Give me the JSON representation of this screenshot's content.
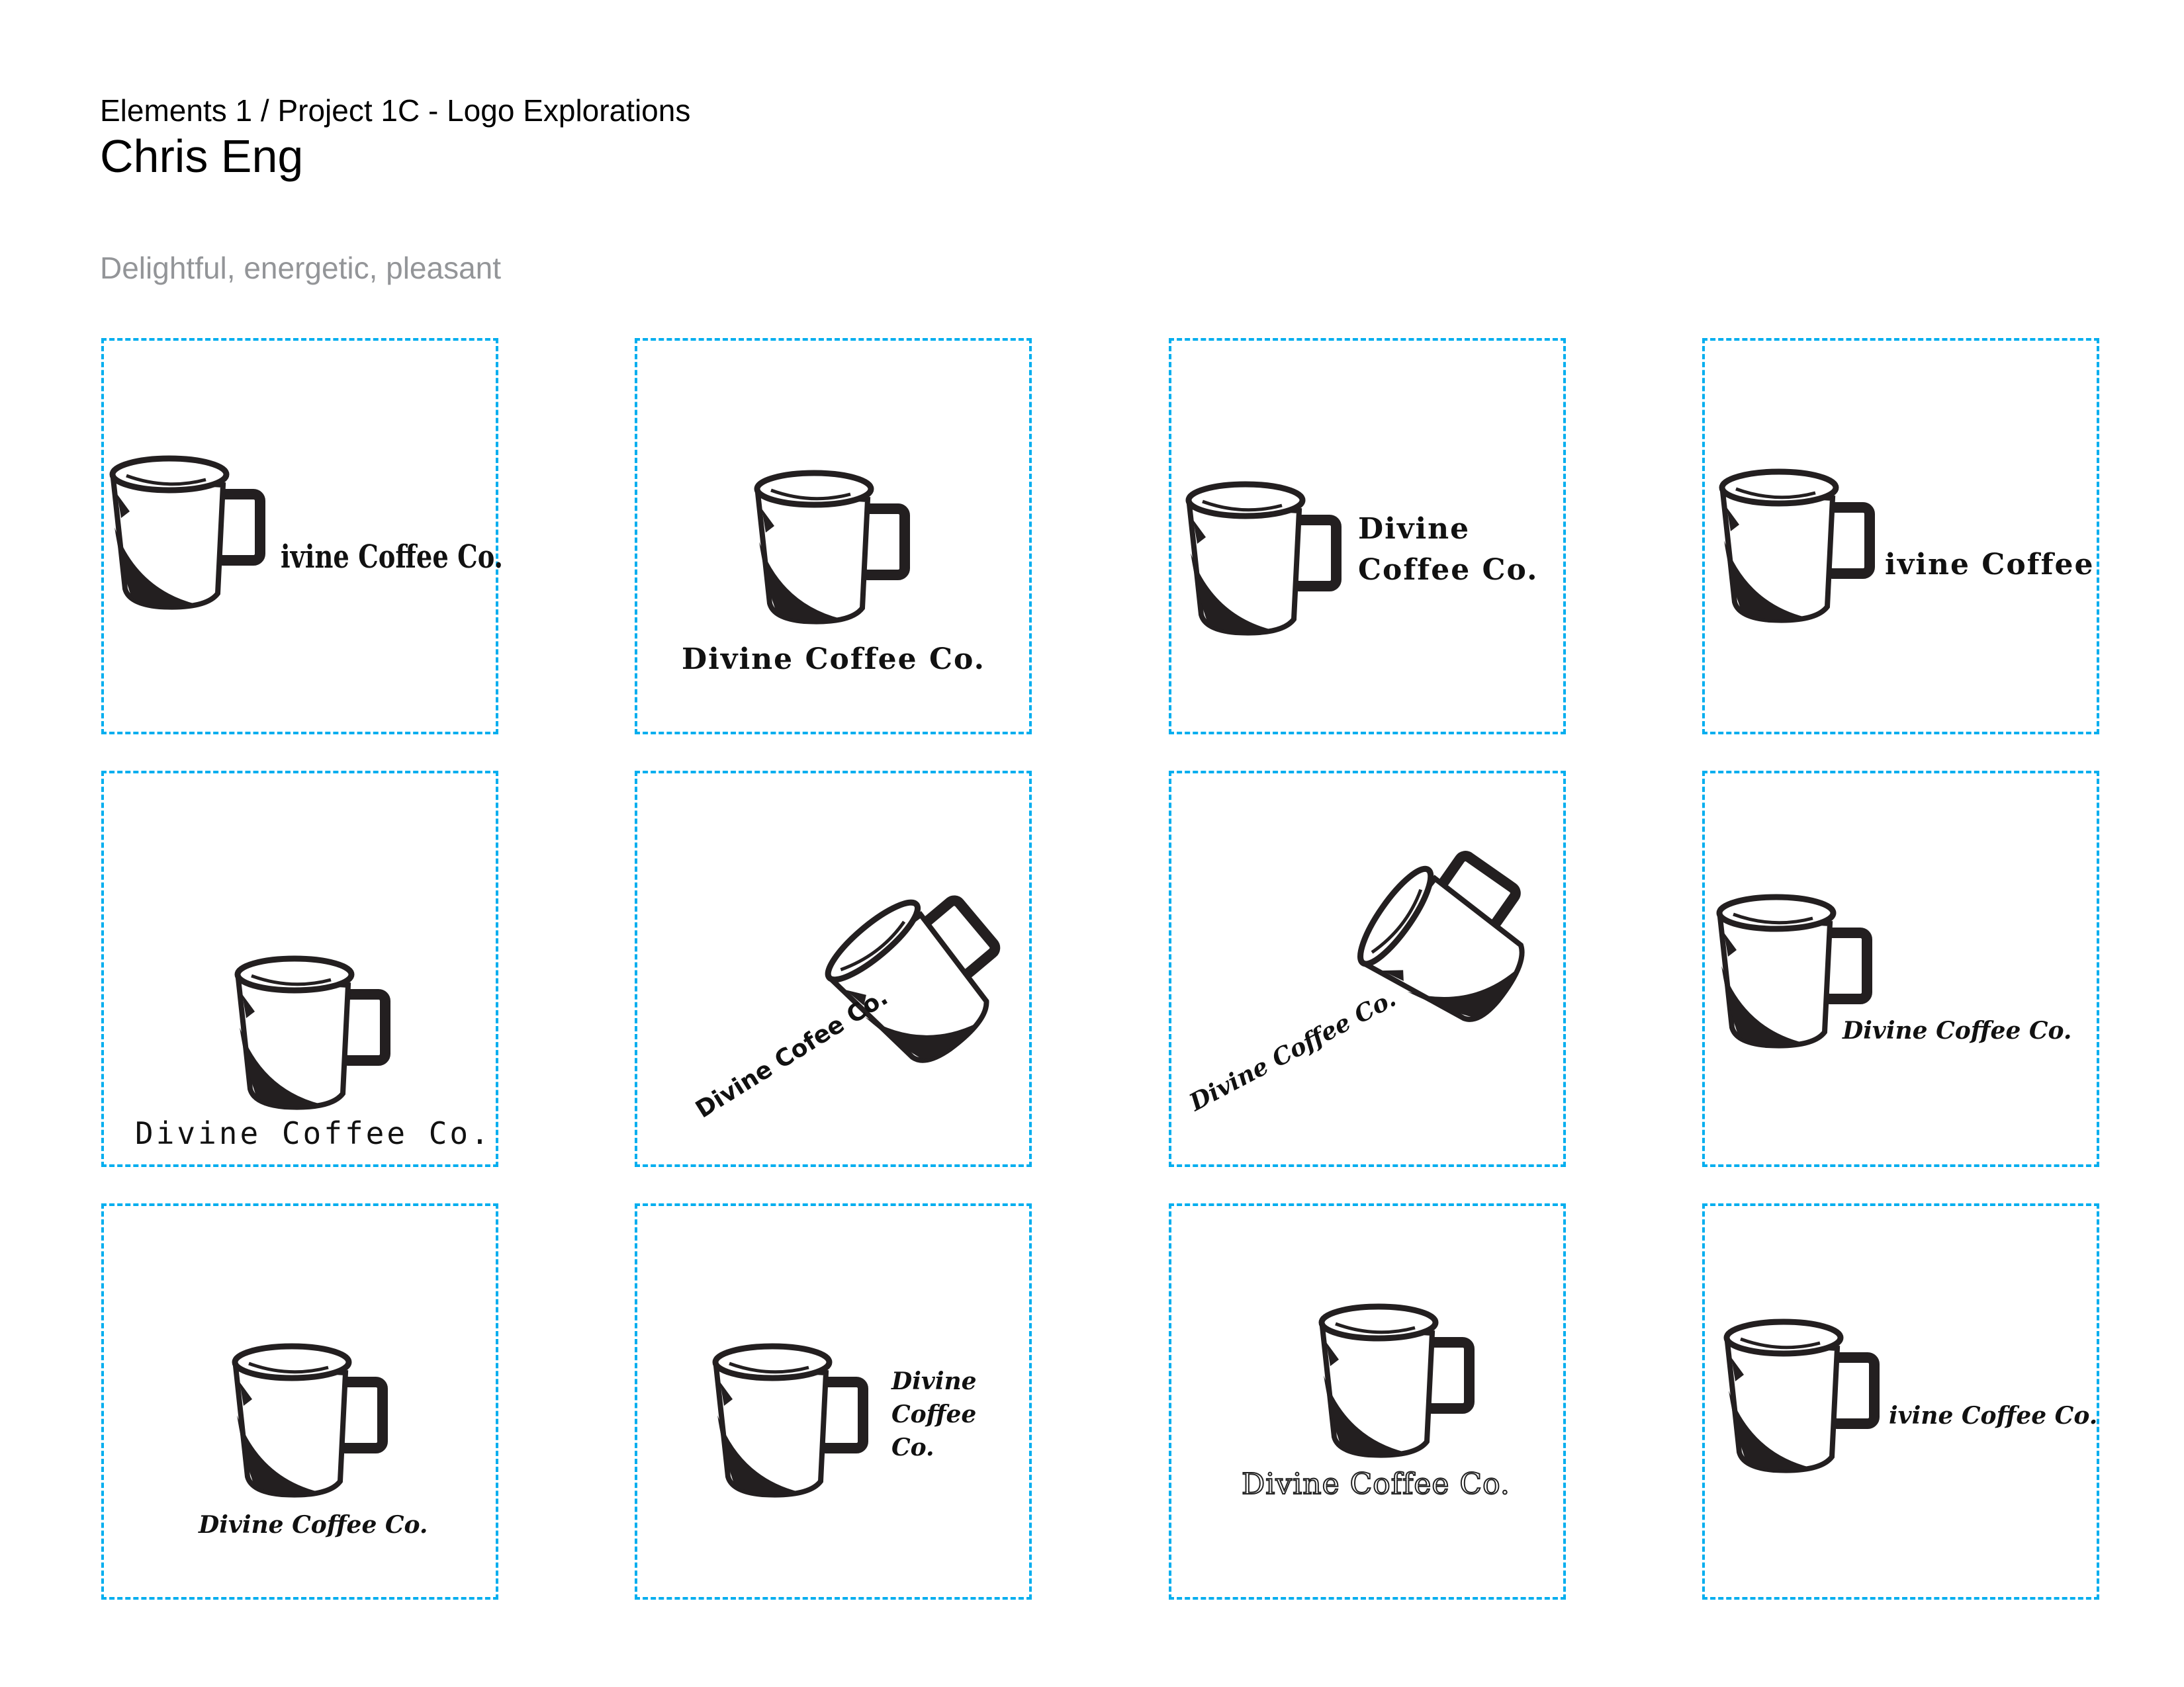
{
  "header": {
    "course": "Elements 1 / Project 1C - Logo Explorations",
    "author": "Chris Eng",
    "tagline": "Delightful, energetic, pleasant"
  },
  "colors": {
    "guide": "#00aeef",
    "ink": "#231f20",
    "tagline": "#939598"
  },
  "cards": [
    {
      "lines": [
        "ivine Coffee Co."
      ]
    },
    {
      "lines": [
        "Divine Coffee Co."
      ]
    },
    {
      "lines": [
        "Divine",
        "Coffee Co."
      ]
    },
    {
      "lines": [
        "ivine Coffee"
      ]
    },
    {
      "lines": [
        "Divine Coffee Co."
      ]
    },
    {
      "lines": [
        "Divine Cofee Co."
      ]
    },
    {
      "lines": [
        "Divine Coffee Co."
      ]
    },
    {
      "lines": [
        "Divine Coffee Co."
      ]
    },
    {
      "lines": [
        "Divine Coffee Co."
      ]
    },
    {
      "lines": [
        "Divine",
        "Coffee",
        "Co."
      ]
    },
    {
      "lines": [
        "Divine Coffee Co."
      ]
    },
    {
      "lines": [
        "ivine Coffee Co."
      ]
    }
  ]
}
